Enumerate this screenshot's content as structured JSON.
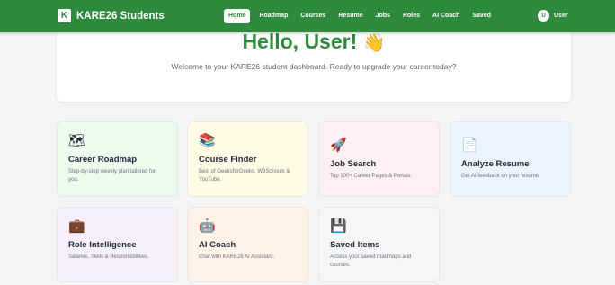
{
  "brand": {
    "logo": "K",
    "name": "KARE26 Students"
  },
  "nav": {
    "items": [
      {
        "label": "Home",
        "active": true
      },
      {
        "label": "Roadmap"
      },
      {
        "label": "Courses"
      },
      {
        "label": "Resume"
      },
      {
        "label": "Jobs"
      },
      {
        "label": "Roles"
      },
      {
        "label": "AI Coach"
      },
      {
        "label": "Saved"
      }
    ],
    "user_initial": "U",
    "user_label": "User"
  },
  "hero": {
    "title": "Hello, User!",
    "wave_emoji": "👋",
    "subtitle": "Welcome to your KARE26 student dashboard. Ready to upgrade your career today?"
  },
  "cards": [
    {
      "title": "Career Roadmap",
      "desc": "Step-by-step weekly plan tailored for you.",
      "icon": "map-icon",
      "glyph": "🗺"
    },
    {
      "title": "Course Finder",
      "desc": "Best of GeeksforGeeks, W3Schools & YouTube.",
      "icon": "books-icon",
      "glyph": "📚"
    },
    {
      "title": "Job Search",
      "desc": "Top 100+ Career Pages & Portals.",
      "icon": "rocket-icon",
      "glyph": "🚀"
    },
    {
      "title": "Analyze Resume",
      "desc": "Get AI feedback on your resume.",
      "icon": "document-icon",
      "glyph": "📄"
    },
    {
      "title": "Role Intelligence",
      "desc": "Salaries, Skills & Responsibilities.",
      "icon": "briefcase-icon",
      "glyph": "💼"
    },
    {
      "title": "AI Coach",
      "desc": "Chat with KARE26 AI Assistant.",
      "icon": "robot-icon",
      "glyph": "🤖"
    },
    {
      "title": "Saved Items",
      "desc": "Access your saved roadmaps and courses.",
      "icon": "save-icon",
      "glyph": "💾"
    }
  ],
  "colors": {
    "brand_green": "#2e8b3e",
    "hero_title": "#2e8b3e"
  }
}
